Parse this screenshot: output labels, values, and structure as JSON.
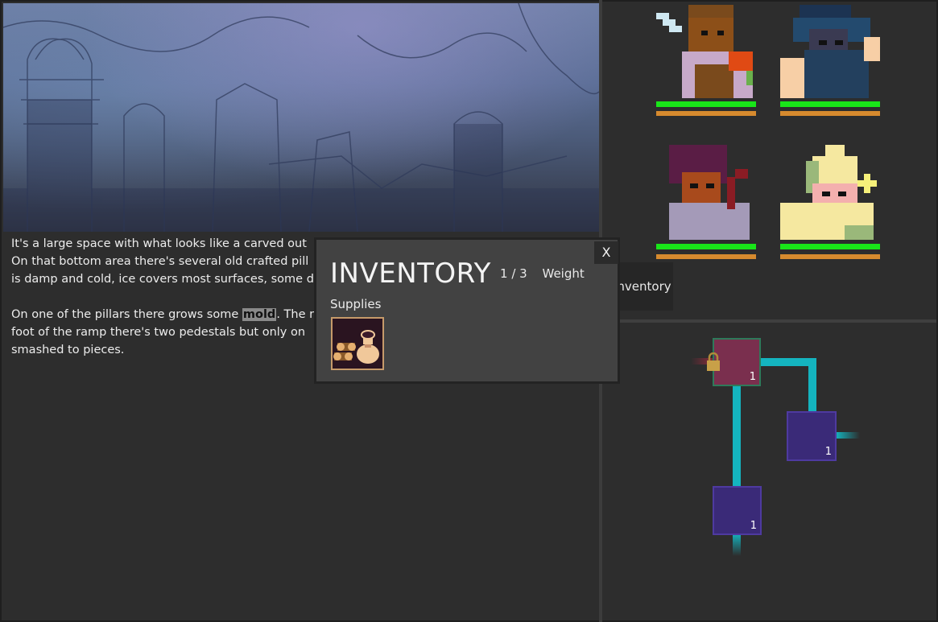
{
  "story": {
    "paragraph1_line1": "It's a large space with what looks like a carved out",
    "paragraph1_line2": "On that bottom area there's several old crafted pill",
    "paragraph1_line3": "is damp and cold, ice covers most surfaces, some d",
    "paragraph2_line1_before": "On one of the pillars there grows some ",
    "paragraph2_keyword": "mold",
    "paragraph2_line1_after": ". The r",
    "paragraph2_line2": "foot of the ramp there's two pedestals but only on",
    "paragraph2_line3": "smashed to pieces."
  },
  "party": [
    {
      "name": "warrior",
      "hp_fraction": 1.0,
      "stamina_fraction": 1.0
    },
    {
      "name": "rogue",
      "hp_fraction": 1.0,
      "stamina_fraction": 1.0
    },
    {
      "name": "bard",
      "hp_fraction": 1.0,
      "stamina_fraction": 1.0
    },
    {
      "name": "cleric",
      "hp_fraction": 1.0,
      "stamina_fraction": 1.0
    }
  ],
  "side_tab": {
    "label": "Inventory"
  },
  "inventory": {
    "title": "INVENTORY",
    "weight_current": "1",
    "weight_sep": "/",
    "weight_max": "3",
    "weight_label": "Weight",
    "close_label": "X",
    "category": "Supplies",
    "items": [
      {
        "icon": "supplies-icon"
      }
    ]
  },
  "map": {
    "nodes": [
      {
        "id": "current-room",
        "count": "1",
        "locked": true
      },
      {
        "id": "east-room",
        "count": "1",
        "locked": false
      },
      {
        "id": "south-room",
        "count": "1",
        "locked": false
      }
    ]
  },
  "colors": {
    "hp": "#19e619",
    "stamina": "#d68a2e",
    "current_room": "#7a2f4e",
    "room": "#3a2a78",
    "corridor": "#14b4bf"
  }
}
